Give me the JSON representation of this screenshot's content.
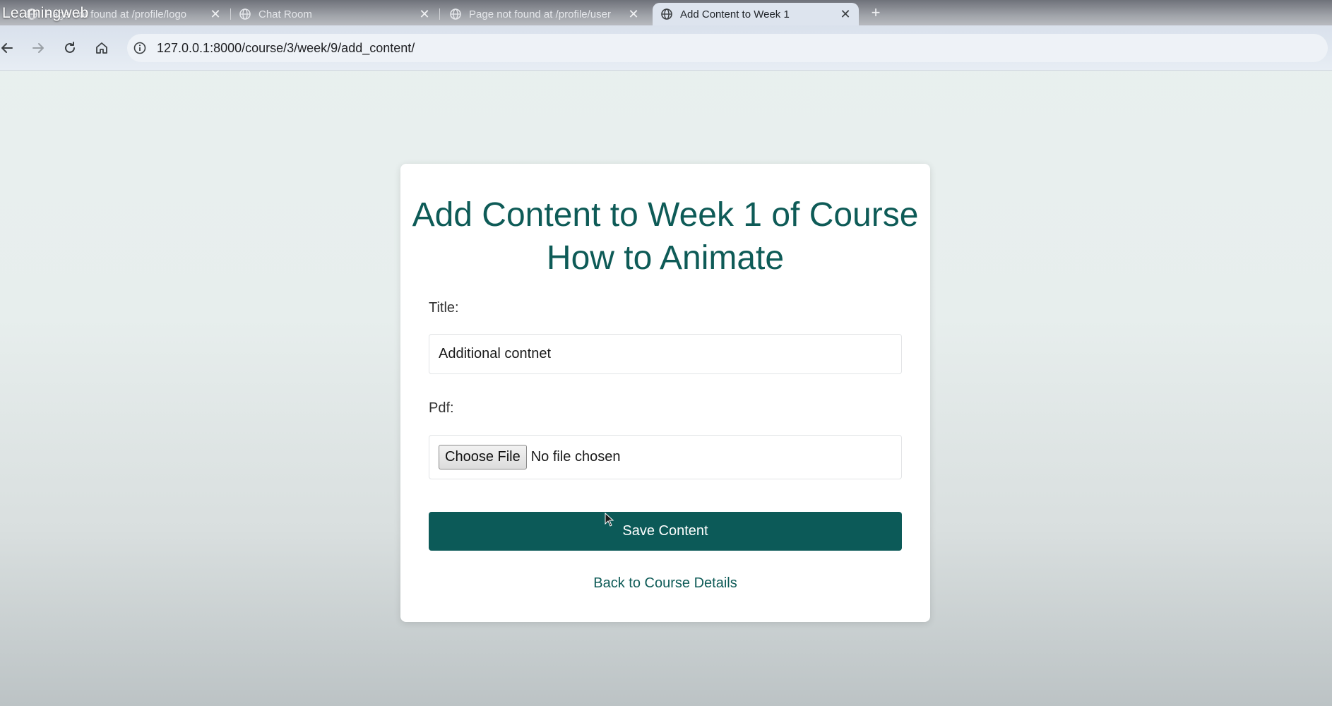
{
  "watermark": "Learningweb",
  "tabs": [
    {
      "label": "Page not found at /profile/logo",
      "favicon": "globe-icon",
      "active": false
    },
    {
      "label": "Chat Room",
      "favicon": "globe-icon",
      "active": false
    },
    {
      "label": "Page not found at /profile/user",
      "favicon": "globe-icon",
      "active": false
    },
    {
      "label": "Add Content to Week 1",
      "favicon": "globe-icon",
      "active": true
    }
  ],
  "toolbar": {
    "url": "127.0.0.1:8000/course/3/week/9/add_content/"
  },
  "form": {
    "heading": "Add Content to Week 1 of Course How to Animate",
    "title_label": "Title:",
    "title_value": "Additional contnet",
    "pdf_label": "Pdf:",
    "choose_file_label": "Choose File",
    "no_file_text": "No file chosen",
    "save_label": "Save Content",
    "back_link": "Back to Course Details"
  },
  "colors": {
    "accent": "#0c5a58",
    "heading": "#0e5b57",
    "background": "#e9f0ef"
  }
}
